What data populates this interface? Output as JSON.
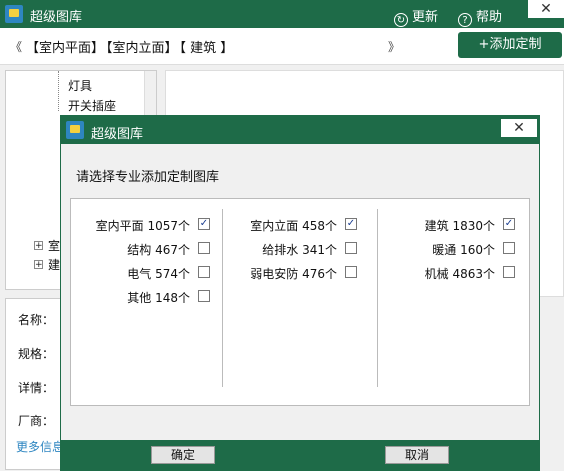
{
  "app": {
    "title": "超级图库",
    "update": "更新",
    "help": "帮助",
    "close_glyph": "✕"
  },
  "nav": {
    "prev": "《",
    "next": "》",
    "crumbs": [
      "【室内平面】",
      "【室内立面】",
      "【   建筑   】"
    ],
    "add_button": "+添加定制"
  },
  "tree": {
    "items": [
      "灯具",
      "开关插座"
    ],
    "collapsed": [
      {
        "plus": "+",
        "label": "室"
      },
      {
        "plus": "+",
        "label": "建"
      }
    ]
  },
  "info": {
    "labels": [
      "名称：",
      "规格：",
      "详情：",
      "厂商："
    ],
    "more": "更多信息"
  },
  "dialog": {
    "title": "超级图库",
    "close_glyph": "✕",
    "prompt": "请选择专业添加定制图库",
    "columns": [
      [
        {
          "label": "室内平面 1057个",
          "checked": true
        },
        {
          "label": "结构 467个",
          "checked": false
        },
        {
          "label": "电气 574个",
          "checked": false
        },
        {
          "label": "其他 148个",
          "checked": false
        }
      ],
      [
        {
          "label": "室内立面 458个",
          "checked": true
        },
        {
          "label": "给排水 341个",
          "checked": false
        },
        {
          "label": "弱电安防 476个",
          "checked": false
        }
      ],
      [
        {
          "label": "建筑 1830个",
          "checked": true
        },
        {
          "label": "暖通 160个",
          "checked": false
        },
        {
          "label": "机械 4863个",
          "checked": false
        }
      ]
    ],
    "ok": "确定",
    "cancel": "取消"
  },
  "colors": {
    "brand": "#1e6b48",
    "link": "#2e86c1"
  }
}
